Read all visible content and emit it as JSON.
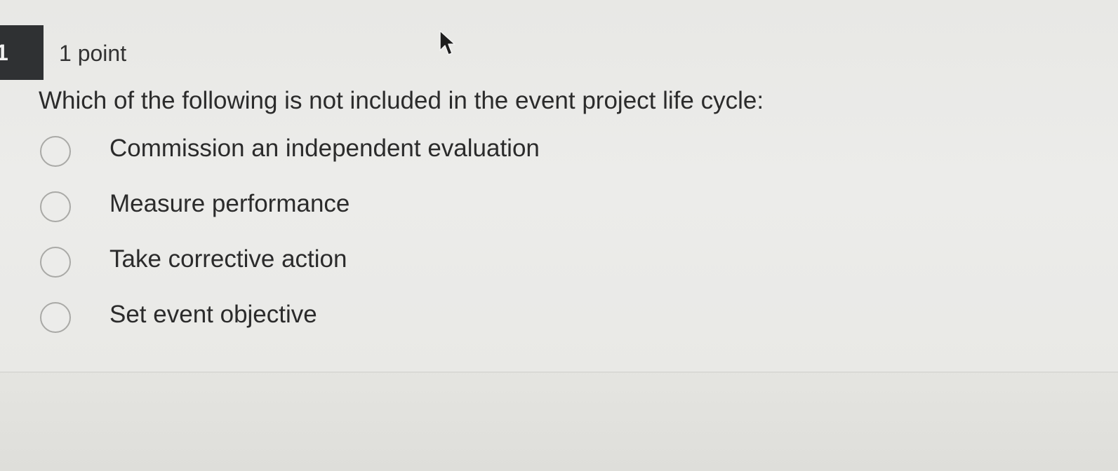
{
  "question": {
    "number": "1",
    "points_label": "1 point",
    "prompt": "Which of the following is not included in the event project life cycle:",
    "options": [
      {
        "label": "Commission an independent evaluation",
        "selected": false
      },
      {
        "label": "Measure performance",
        "selected": false
      },
      {
        "label": "Take corrective action",
        "selected": false
      },
      {
        "label": "Set event objective",
        "selected": false
      }
    ]
  },
  "icons": {
    "cursor": "mouse-pointer-icon",
    "radio": "radio-button-unchecked"
  },
  "colors": {
    "badge_bg": "#2f3133",
    "text": "#2b2b2b",
    "radio_border": "#a9a9a6",
    "background": "#e9e9e6"
  }
}
